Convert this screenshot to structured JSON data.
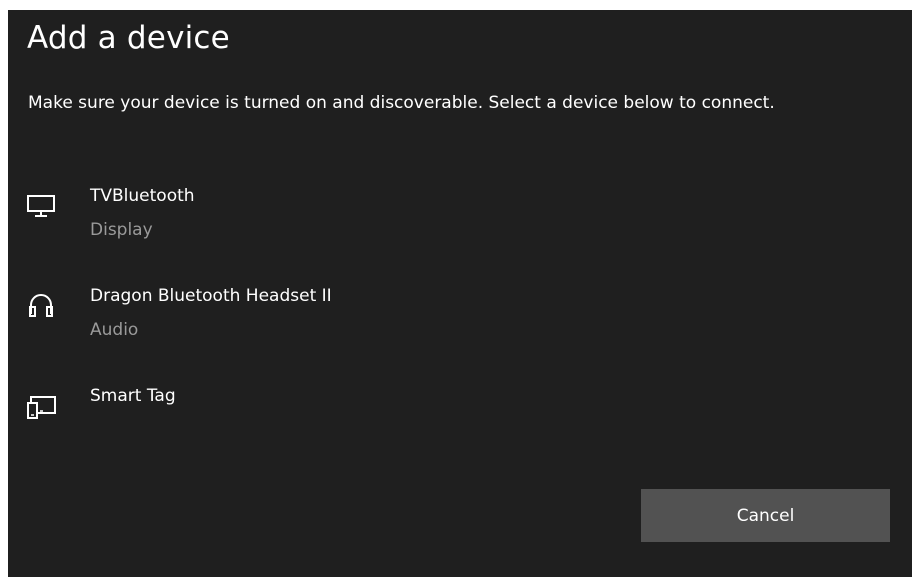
{
  "dialog": {
    "title": "Add a device",
    "instructions": "Make sure your device is turned on and discoverable. Select a device below to connect."
  },
  "devices": [
    {
      "name": "TVBluetooth",
      "kind": "Display",
      "icon": "monitor-icon"
    },
    {
      "name": "Dragon Bluetooth Headset II",
      "kind": "Audio",
      "icon": "headphones-icon"
    },
    {
      "name": "Smart Tag",
      "kind": "",
      "icon": "devices-icon"
    }
  ],
  "actions": {
    "cancel_label": "Cancel"
  },
  "colors": {
    "background": "#1f1f1f",
    "text": "#ffffff",
    "secondary_text": "#9a9a9a",
    "button": "#525252"
  }
}
